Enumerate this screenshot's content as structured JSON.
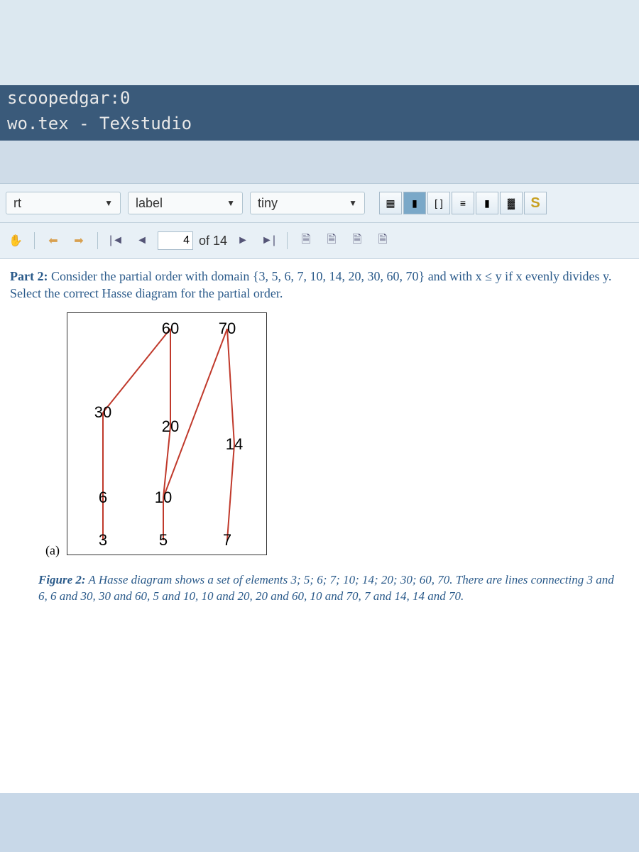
{
  "desktop": {
    "line1": "scoopedgar:0",
    "line2": "wo.tex - TeXstudio"
  },
  "toolbar1": {
    "dropdown1": "rt",
    "dropdown2": "label",
    "dropdown3": "tiny"
  },
  "toolbar2": {
    "page_current": "4",
    "page_of_label": "of 14"
  },
  "problem": {
    "prefix": "Part 2:",
    "body": "Consider the partial order with domain {3, 5, 6, 7, 10, 14, 20, 30, 60, 70} and with x ≤ y if x evenly divides y. Select the correct Hasse diagram for the partial order."
  },
  "figure": {
    "sublabel": "(a)",
    "nodes": {
      "n60": "60",
      "n70": "70",
      "n30": "30",
      "n20": "20",
      "n14": "14",
      "n6": "6",
      "n10": "10",
      "n3": "3",
      "n5": "5",
      "n7": "7"
    }
  },
  "caption": {
    "prefix": "Figure 2:",
    "body": "A Hasse diagram shows a set of elements 3; 5; 6; 7; 10; 14; 20; 30; 60, 70. There are lines connecting 3 and 6, 6 and 30, 30 and 60, 5 and 10, 10 and 20, 20 and 60, 10 and 70, 7 and 14, 14 and 70."
  },
  "chart_data": {
    "type": "diagram",
    "title": "Hasse diagram",
    "elements": [
      3,
      5,
      6,
      7,
      10,
      14,
      20,
      30,
      60,
      70
    ],
    "edges": [
      [
        3,
        6
      ],
      [
        6,
        30
      ],
      [
        30,
        60
      ],
      [
        5,
        10
      ],
      [
        10,
        20
      ],
      [
        20,
        60
      ],
      [
        10,
        70
      ],
      [
        7,
        14
      ],
      [
        14,
        70
      ]
    ]
  }
}
